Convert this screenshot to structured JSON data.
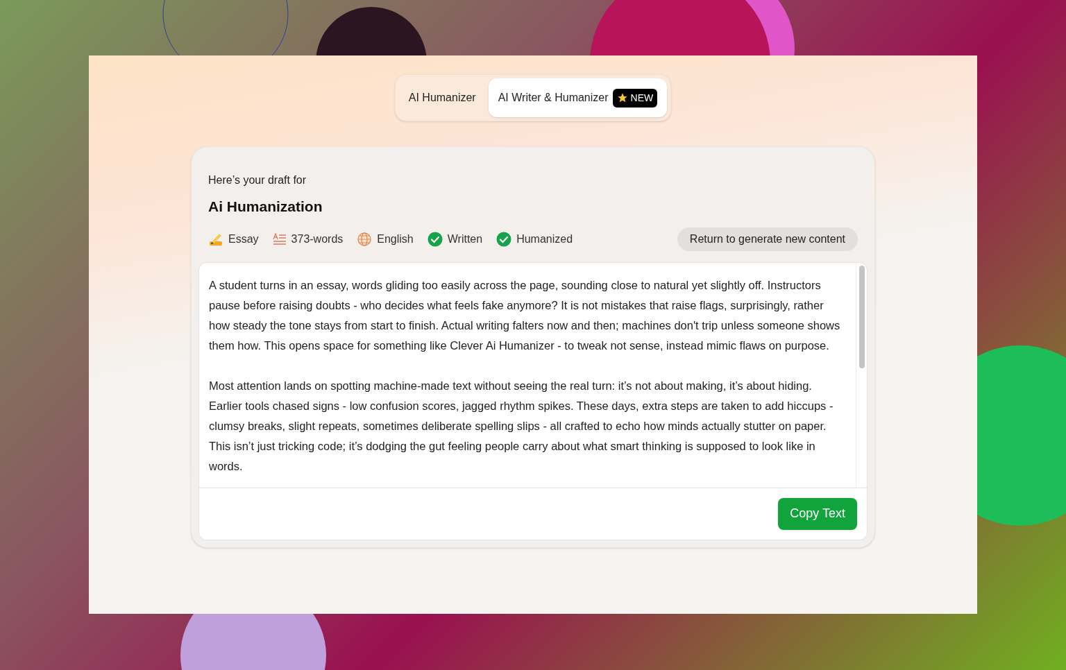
{
  "tabs": [
    {
      "label": "AI Humanizer",
      "selected": false
    },
    {
      "label": "AI Writer & Humanizer",
      "selected": true,
      "badge": "NEW"
    }
  ],
  "draft": {
    "intro": "Here’s your draft for",
    "title": "Ai Humanization",
    "meta": [
      {
        "kind": "essay",
        "label": "Essay"
      },
      {
        "kind": "words",
        "label": "373-words"
      },
      {
        "kind": "language",
        "label": "English"
      },
      {
        "kind": "status",
        "label": "Written",
        "checked": true
      },
      {
        "kind": "status",
        "label": "Humanized",
        "checked": true
      }
    ],
    "return_button": "Return to generate new content",
    "paragraphs": [
      "A student turns in an essay, words gliding too easily across the page, sounding close to natural yet slightly off. Instructors pause before raising doubts - who decides what feels fake anymore? It is not mistakes that raise flags, surprisingly, rather how steady the tone stays from start to finish. Actual writing falters now and then; machines don't trip unless someone shows them how. This opens space for something like Clever Ai Humanizer - to tweak not sense, instead mimic flaws on purpose.",
      "Most attention lands on spotting machine-made text without seeing the real turn: it’s not about making, it’s about hiding. Earlier tools chased signs - low confusion scores, jagged rhythm spikes. These days, extra steps are taken to add hiccups - clumsy breaks, slight repeats, sometimes deliberate spelling slips - all crafted to echo how minds actually stutter on paper. This isn’t just tricking code; it’s dodging the gut feeling people carry about what smart thinking is supposed to look like in words."
    ],
    "copy_button": "Copy Text"
  }
}
